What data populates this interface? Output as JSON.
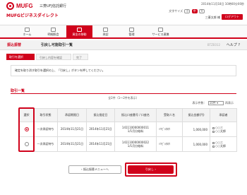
{
  "header": {
    "brand": "MUFG",
    "bank": "三菱UFJ信託銀行",
    "service": "MUFGビジネスダイレクト",
    "timestamp": "2014年11月18日 10時00分00秒",
    "font_size_label": "文字サイズ",
    "font_small": "小",
    "font_mid": "中",
    "font_large": "大",
    "user": "三菱太郎 様",
    "logout": "ログアウト"
  },
  "nav": [
    {
      "label": "ホーム"
    },
    {
      "label": "明細照会"
    },
    {
      "label": "資金の移動"
    },
    {
      "label": "承認"
    },
    {
      "label": "管理"
    },
    {
      "label": "サービス連携"
    }
  ],
  "page": {
    "category": "振込振替",
    "title": "引戻し可能取引一覧",
    "code": "BTZE012",
    "help": "ヘルプ"
  },
  "steps": [
    "取引を選択",
    "引戻し内容を確認",
    "完了"
  ],
  "instruction": "確定を取り消す取引を選択の上、「引戻し」ボタンを押してください。",
  "list": {
    "title": "取引一覧",
    "count": "全2件（1〜2件を表示）",
    "per_page_label": "表示件数：",
    "per_page_value": "10件",
    "per_page_suffix": "再表示",
    "headers": {
      "select": "選択",
      "status": "取引状態",
      "designated": "承認期限日",
      "date": "振込指定日",
      "account": "振込口座番号 / 口座名",
      "payee": "受取人名",
      "amount": "振込金額(円)",
      "approver": "承認者"
    },
    "rows": [
      {
        "selected": true,
        "status": "一次承認待ち",
        "designated": "2014年11月21日",
        "date": "2014年11月21日",
        "account_no": "141110000000011",
        "account_name": "1/1月分給料",
        "payee": "ﾐﾂﾋﾞｼﾀﾛｳ",
        "amount": "1,000,000",
        "approver1": "○○三",
        "approver2": "○○太郎"
      },
      {
        "selected": false,
        "status": "一次承認待ち",
        "designated": "2014年11月21日",
        "date": "2014年11月21日",
        "account_no": "141110000000022",
        "account_name": "1/1月分給料",
        "payee": "ﾐﾂﾋﾞｼﾀﾛｳ",
        "amount": "1,000,000",
        "approver1": "○○三",
        "approver2": "○○太郎"
      }
    ]
  },
  "buttons": {
    "back": "振込振替メニューへ",
    "next": "引戻し"
  }
}
